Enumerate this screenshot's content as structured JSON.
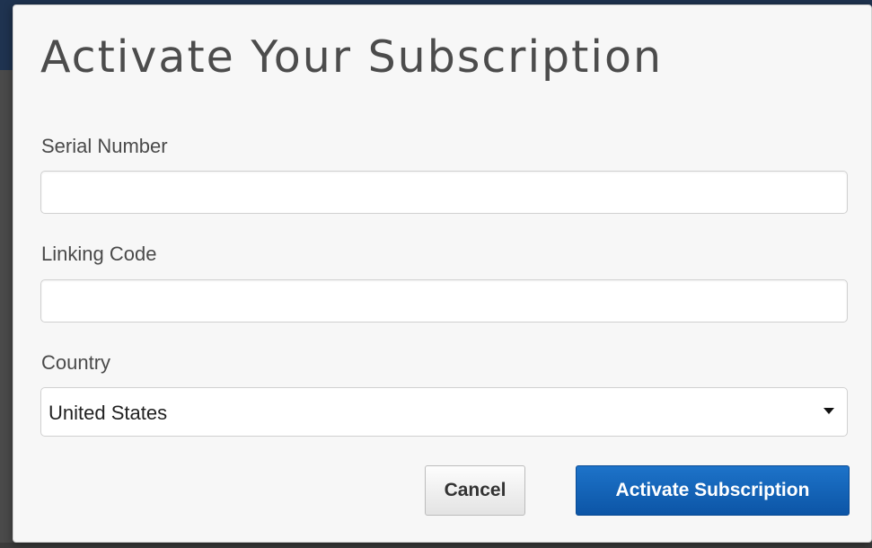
{
  "modal": {
    "title": "Activate Your Subscription",
    "fields": {
      "serial_number": {
        "label": "Serial Number",
        "value": "",
        "placeholder": ""
      },
      "linking_code": {
        "label": "Linking Code",
        "value": "",
        "placeholder": ""
      },
      "country": {
        "label": "Country",
        "selected": "United States"
      }
    },
    "buttons": {
      "cancel": "Cancel",
      "activate": "Activate Subscription"
    },
    "icons": {
      "country_select": "caret-down-icon"
    },
    "colors": {
      "primary_button": "#0c55a6",
      "page_header_background": "#1f3350"
    }
  }
}
